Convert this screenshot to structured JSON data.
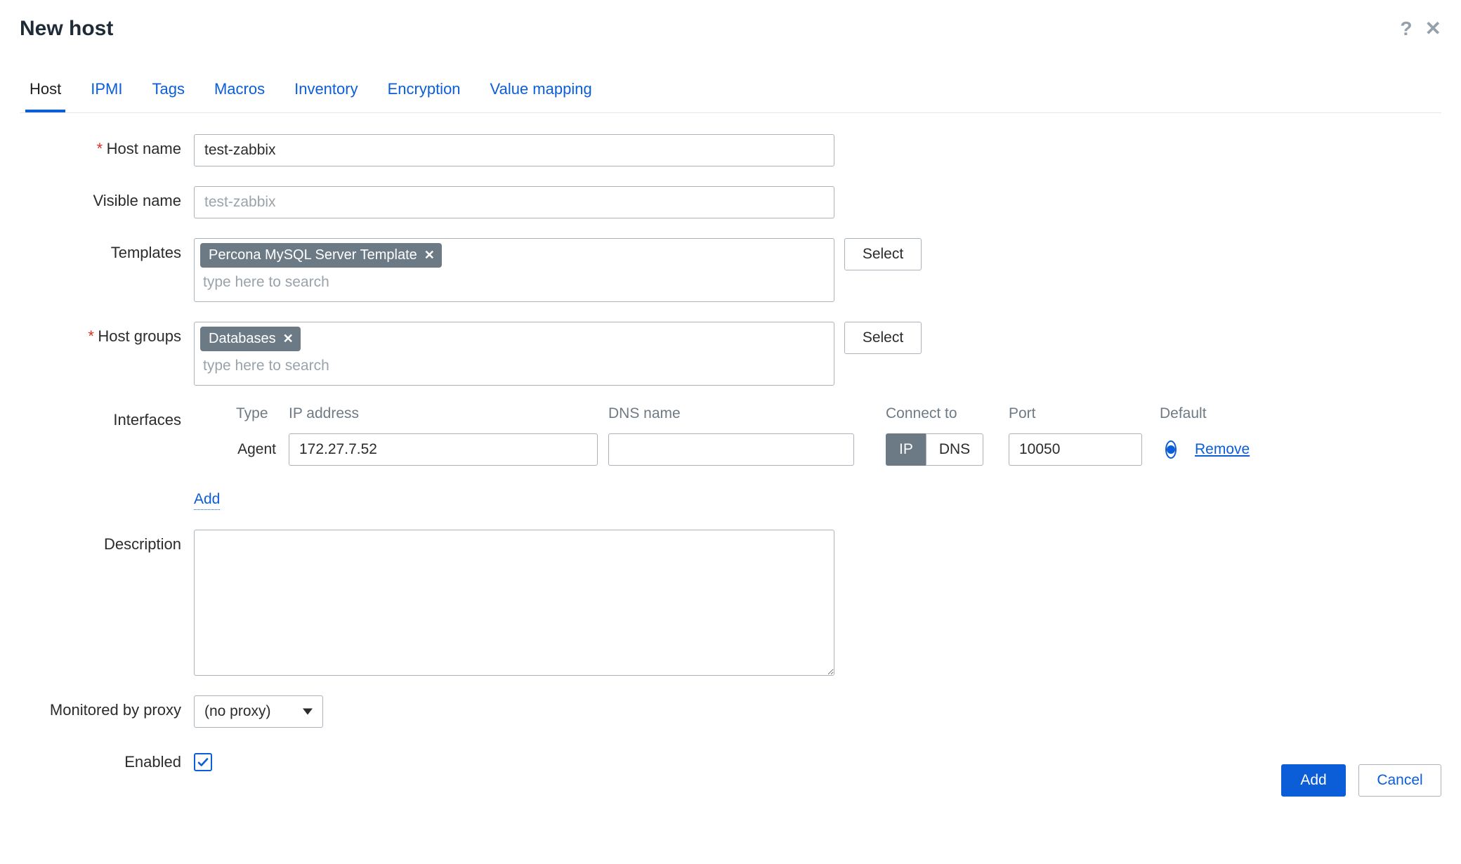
{
  "dialog": {
    "title": "New host"
  },
  "tabs": [
    {
      "label": "Host",
      "active": true
    },
    {
      "label": "IPMI",
      "active": false
    },
    {
      "label": "Tags",
      "active": false
    },
    {
      "label": "Macros",
      "active": false
    },
    {
      "label": "Inventory",
      "active": false
    },
    {
      "label": "Encryption",
      "active": false
    },
    {
      "label": "Value mapping",
      "active": false
    }
  ],
  "labels": {
    "host_name": "Host name",
    "visible_name": "Visible name",
    "templates": "Templates",
    "host_groups": "Host groups",
    "interfaces": "Interfaces",
    "description": "Description",
    "proxy": "Monitored by proxy",
    "enabled": "Enabled"
  },
  "fields": {
    "host_name": {
      "value": "test-zabbix"
    },
    "visible_name": {
      "value": "",
      "placeholder": "test-zabbix"
    },
    "templates": {
      "pills": [
        "Percona MySQL Server Template"
      ],
      "placeholder": "type here to search"
    },
    "host_groups": {
      "pills": [
        "Databases"
      ],
      "placeholder": "type here to search"
    },
    "description": {
      "value": ""
    },
    "proxy": {
      "value": "(no proxy)"
    },
    "enabled": {
      "checked": true
    }
  },
  "buttons": {
    "select": "Select",
    "add": "Add",
    "cancel": "Cancel",
    "add_iface": "Add",
    "remove": "Remove"
  },
  "interfaces": {
    "headers": {
      "type": "Type",
      "ip": "IP address",
      "dns": "DNS name",
      "connect": "Connect to",
      "port": "Port",
      "default": "Default"
    },
    "rows": [
      {
        "type": "Agent",
        "ip": "172.27.7.52",
        "dns": "",
        "connect_to": "IP",
        "port": "10050",
        "default": true
      }
    ],
    "connect_labels": {
      "ip": "IP",
      "dns": "DNS"
    }
  }
}
